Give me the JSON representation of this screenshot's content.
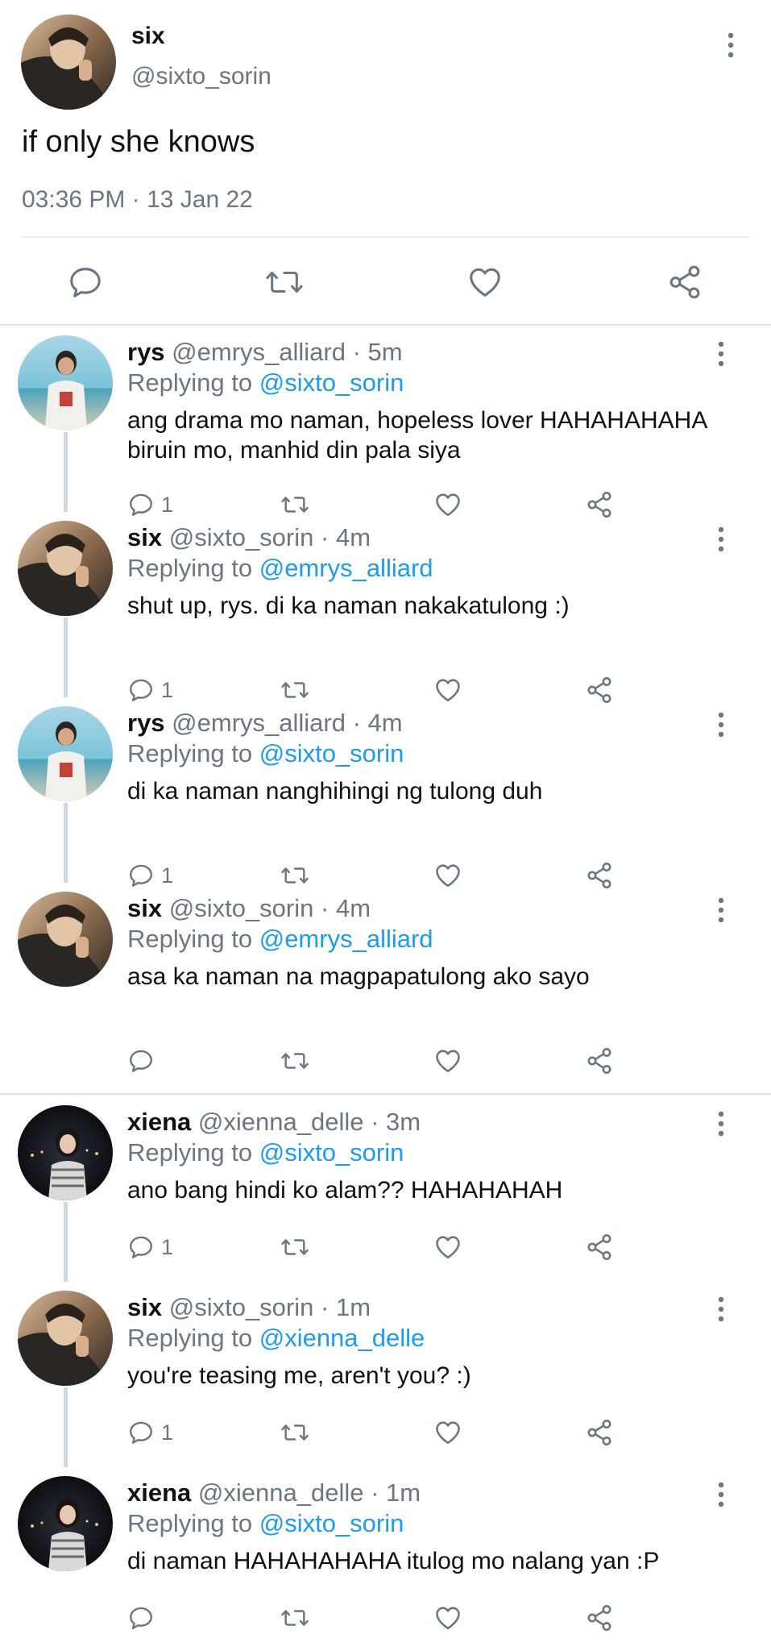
{
  "main_tweet": {
    "name": "six",
    "handle": "@sixto_sorin",
    "text": "if only she knows",
    "timestamp": "03:36 PM · 13 Jan 22"
  },
  "replies": [
    {
      "name": "rys",
      "handle": "@emrys_alliard",
      "time": "· 5m",
      "replying_label": "Replying to",
      "replying_to": "@sixto_sorin",
      "text": "ang drama mo naman, hopeless lover HAHAHAHAHA biruin mo, manhid din pala siya",
      "reply_count": "1",
      "avatar": "rys"
    },
    {
      "name": "six",
      "handle": "@sixto_sorin",
      "time": "· 4m",
      "replying_label": "Replying to",
      "replying_to": "@emrys_alliard",
      "text": "shut up, rys. di ka naman nakakatulong :)",
      "reply_count": "1",
      "avatar": "six"
    },
    {
      "name": "rys",
      "handle": "@emrys_alliard",
      "time": "· 4m",
      "replying_label": "Replying to",
      "replying_to": "@sixto_sorin",
      "text": "di ka naman nanghihingi ng tulong duh",
      "reply_count": "1",
      "avatar": "rys"
    },
    {
      "name": "six",
      "handle": "@sixto_sorin",
      "time": "· 4m",
      "replying_label": "Replying to",
      "replying_to": "@emrys_alliard",
      "text": "asa ka naman na magpapatulong ako sayo",
      "reply_count": "",
      "avatar": "six"
    },
    {
      "name": "xiena",
      "handle": "@xienna_delle",
      "time": "· 3m",
      "replying_label": "Replying to",
      "replying_to": "@sixto_sorin",
      "text": "ano bang hindi ko alam?? HAHAHAHAH",
      "reply_count": "1",
      "avatar": "xiena"
    },
    {
      "name": "six",
      "handle": "@sixto_sorin",
      "time": "· 1m",
      "replying_label": "Replying to",
      "replying_to": "@xienna_delle",
      "text": "you're teasing me, aren't you? :)",
      "reply_count": "1",
      "avatar": "six"
    },
    {
      "name": "xiena",
      "handle": "@xienna_delle",
      "time": "· 1m",
      "replying_label": "Replying to",
      "replying_to": "@sixto_sorin",
      "text": "di naman HAHAHAHAHA itulog mo nalang yan :P",
      "reply_count": "",
      "avatar": "xiena"
    }
  ],
  "icons": {
    "reply": "reply-icon",
    "retweet": "retweet-icon",
    "like": "heart-icon",
    "share": "share-icon",
    "more": "more-vertical-icon"
  },
  "colors": {
    "link": "#1d9bf0",
    "secondary_text": "#6b7680",
    "icon": "#6b7680",
    "divider": "#e6ecf0"
  }
}
